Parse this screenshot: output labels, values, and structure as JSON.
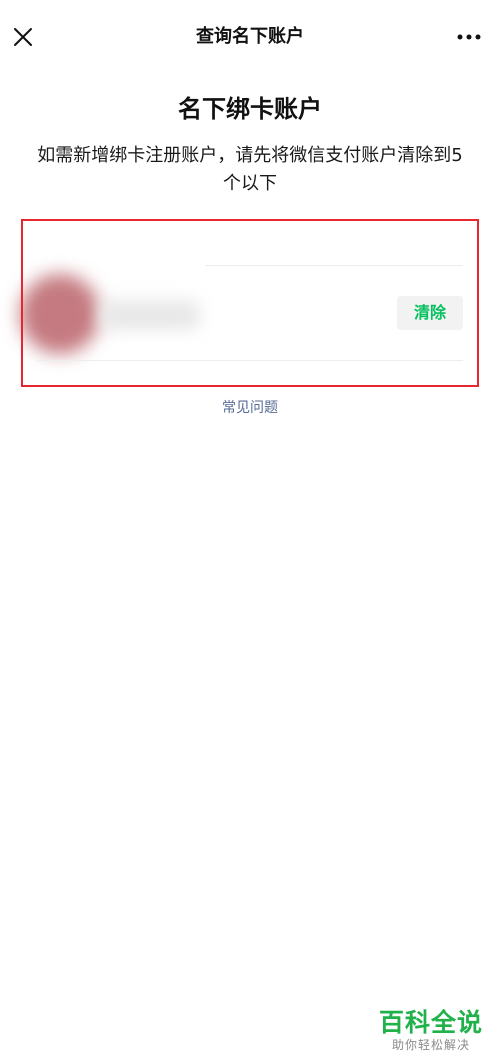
{
  "navbar": {
    "title": "查询名下账户",
    "close_icon": "close-icon",
    "more_icon": "more-icon"
  },
  "main": {
    "heading": "名下绑卡账户",
    "subtitle": "如需新增绑卡注册账户，请先将微信支付账户清除到5个以下"
  },
  "account": {
    "clear_label": "清除"
  },
  "faq": {
    "label": "常见问题"
  },
  "watermark": {
    "main": "百科全说",
    "sub": "助你轻松解决"
  },
  "colors": {
    "accent_green": "#07c160",
    "link_blue": "#576b95",
    "highlight_red": "#e8262e"
  }
}
